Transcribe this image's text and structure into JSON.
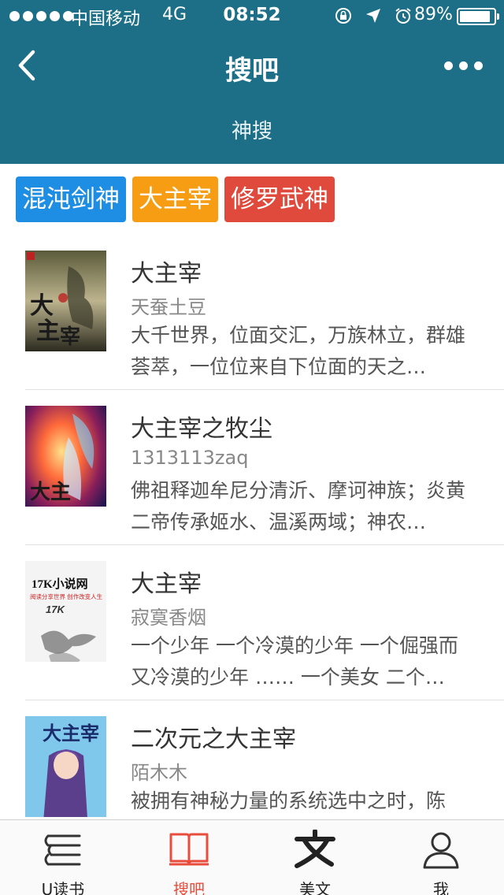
{
  "status_bar": {
    "carrier": "中国移动",
    "network": "4G",
    "time": "08:52",
    "battery_percent": "89%",
    "icons": [
      "rotation-lock-icon",
      "location-arrow-icon",
      "alarm-icon"
    ]
  },
  "nav": {
    "title": "搜吧",
    "subtitle": "神搜"
  },
  "tags": [
    {
      "label": "混沌剑神",
      "color": "#1e8ee5"
    },
    {
      "label": "大主宰",
      "color": "#f69d13"
    },
    {
      "label": "修罗武神",
      "color": "#df4a3c"
    }
  ],
  "books": [
    {
      "title": "大主宰",
      "author": "天蚕土豆",
      "description": "大千世界，位面交汇，万族林立，群雄荟萃，一位位来自下位面的天之…"
    },
    {
      "title": "大主宰之牧尘",
      "author": "1313113zaq",
      "description": "佛祖释迦牟尼分清沂、摩诃神族；炎黄二帝传承姬水、温溪两域；神农…"
    },
    {
      "title": "大主宰",
      "author": "寂寞香烟",
      "description": "一个少年 一个冷漠的少年 一个倔强而又冷漠的少年 …… 一个美女 二个…",
      "cover_text": {
        "brand": "17K小说网",
        "slogan": "阅读分享世界 创作改变人生",
        "logo": "17K"
      }
    },
    {
      "title": "二次元之大主宰",
      "author": "陌木木",
      "description": "被拥有神秘力量的系统选中之时，陈",
      "cover_text": {
        "title": "大主宰"
      }
    }
  ],
  "tabbar": [
    {
      "label": "U读书",
      "icon": "book-stack-icon",
      "active": false
    },
    {
      "label": "搜吧",
      "icon": "open-book-icon",
      "active": true
    },
    {
      "label": "美文",
      "icon": "wen-character-icon",
      "active": false
    },
    {
      "label": "我",
      "icon": "person-icon",
      "active": false
    }
  ],
  "colors": {
    "header": "#1c6f86",
    "active_tab": "#e84c3d"
  }
}
